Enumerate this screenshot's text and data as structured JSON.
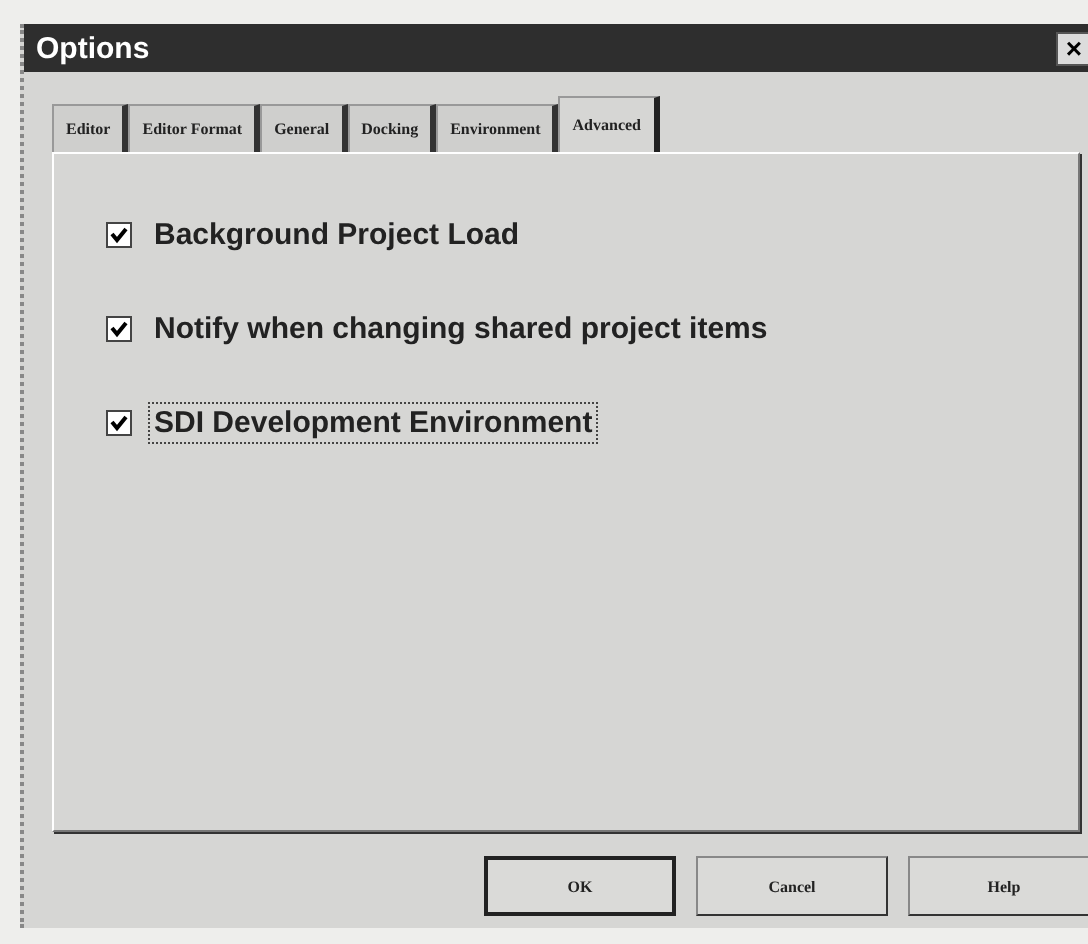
{
  "window": {
    "title": "Options",
    "close": "×"
  },
  "tabs": [
    {
      "label": "Editor",
      "selected": false
    },
    {
      "label": "Editor Format",
      "selected": false
    },
    {
      "label": "General",
      "selected": false
    },
    {
      "label": "Docking",
      "selected": false
    },
    {
      "label": "Environment",
      "selected": false
    },
    {
      "label": "Advanced",
      "selected": true
    }
  ],
  "options": [
    {
      "label": "Background Project Load",
      "checked": true,
      "focused": false
    },
    {
      "label": "Notify when changing shared project items",
      "checked": true,
      "focused": false
    },
    {
      "label": "SDI Development Environment",
      "checked": true,
      "focused": true
    }
  ],
  "buttons": [
    {
      "label": "OK",
      "default": true
    },
    {
      "label": "Cancel",
      "default": false
    },
    {
      "label": "Help",
      "default": false
    }
  ]
}
